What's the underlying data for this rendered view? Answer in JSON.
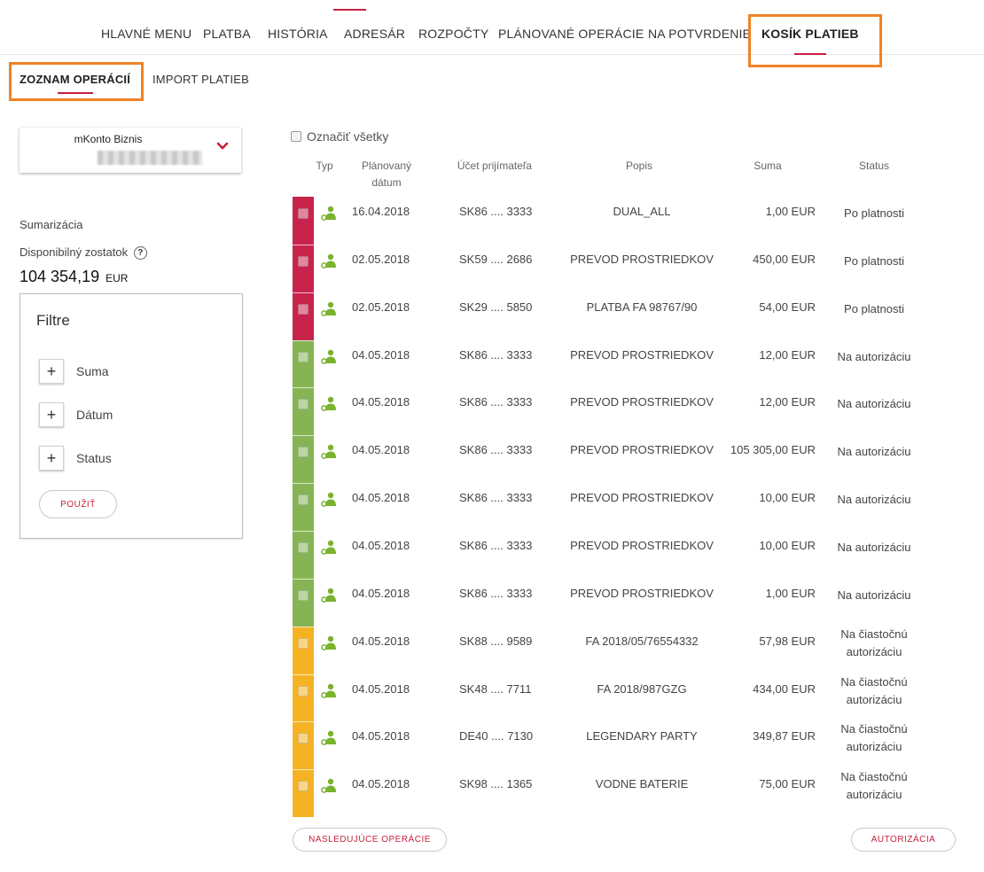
{
  "nav": {
    "items": [
      {
        "label": "HLAVNÉ MENU"
      },
      {
        "label": "PLATBA"
      },
      {
        "label": "HISTÓRIA"
      },
      {
        "label": "ADRESÁR"
      },
      {
        "label": "ROZPOČTY"
      },
      {
        "label": "PLÁNOVANÉ OPERÁCIE"
      },
      {
        "label": "NA POTVRDENIE"
      },
      {
        "label": "KOSÍK PLATIEB",
        "active": true
      }
    ]
  },
  "subnav": {
    "items": [
      {
        "label": "ZOZNAM OPERÁCIÍ",
        "active": true
      },
      {
        "label": "IMPORT PLATIEB"
      }
    ]
  },
  "account": {
    "name": "mKonto Biznis"
  },
  "summary": {
    "title": "Sumarizácia",
    "available_label": "Disponibilný zostatok",
    "help_icon": "?",
    "balance": "104 354,19",
    "currency": "EUR"
  },
  "filters": {
    "title": "Filtre",
    "items": [
      {
        "label": "Suma",
        "icon": "+"
      },
      {
        "label": "Dátum",
        "icon": "+"
      },
      {
        "label": "Status",
        "icon": "+"
      }
    ],
    "apply_label": "POUŽIŤ"
  },
  "table": {
    "select_all_label": "Označiť všetky",
    "headers": {
      "type": "Typ",
      "date_line1": "Plánovaný",
      "date_line2": "dátum",
      "account": "Účet prijímateľa",
      "description": "Popis",
      "amount": "Suma",
      "status": "Status"
    },
    "rows": [
      {
        "date": "16.04.2018",
        "account": "SK86 .... 3333",
        "description": "DUAL_ALL",
        "amount": "1,00 EUR",
        "status1": "Po platnosti",
        "status2": "",
        "color": "red"
      },
      {
        "date": "02.05.2018",
        "account": "SK59 .... 2686",
        "description": "PREVOD PROSTRIEDKOV",
        "amount": "450,00 EUR",
        "status1": "Po platnosti",
        "status2": "",
        "color": "red"
      },
      {
        "date": "02.05.2018",
        "account": "SK29 .... 5850",
        "description": "PLATBA FA 98767/90",
        "amount": "54,00 EUR",
        "status1": "Po platnosti",
        "status2": "",
        "color": "red"
      },
      {
        "date": "04.05.2018",
        "account": "SK86 .... 3333",
        "description": "PREVOD PROSTRIEDKOV",
        "amount": "12,00 EUR",
        "status1": "Na autorizáciu",
        "status2": "",
        "color": "green"
      },
      {
        "date": "04.05.2018",
        "account": "SK86 .... 3333",
        "description": "PREVOD PROSTRIEDKOV",
        "amount": "12,00 EUR",
        "status1": "Na autorizáciu",
        "status2": "",
        "color": "green"
      },
      {
        "date": "04.05.2018",
        "account": "SK86 .... 3333",
        "description": "PREVOD PROSTRIEDKOV",
        "amount": "105 305,00 EUR",
        "status1": "Na autorizáciu",
        "status2": "",
        "color": "green"
      },
      {
        "date": "04.05.2018",
        "account": "SK86 .... 3333",
        "description": "PREVOD PROSTRIEDKOV",
        "amount": "10,00 EUR",
        "status1": "Na autorizáciu",
        "status2": "",
        "color": "green"
      },
      {
        "date": "04.05.2018",
        "account": "SK86 .... 3333",
        "description": "PREVOD PROSTRIEDKOV",
        "amount": "10,00 EUR",
        "status1": "Na autorizáciu",
        "status2": "",
        "color": "green"
      },
      {
        "date": "04.05.2018",
        "account": "SK86 .... 3333",
        "description": "PREVOD PROSTRIEDKOV",
        "amount": "1,00 EUR",
        "status1": "Na autorizáciu",
        "status2": "",
        "color": "green"
      },
      {
        "date": "04.05.2018",
        "account": "SK88 .... 9589",
        "description": "FA 2018/05/76554332",
        "amount": "57,98 EUR",
        "status1": "Na čiastočnú",
        "status2": "autorizáciu",
        "color": "yellow"
      },
      {
        "date": "04.05.2018",
        "account": "SK48 .... 7711",
        "description": "FA 2018/987GZG",
        "amount": "434,00 EUR",
        "status1": "Na čiastočnú",
        "status2": "autorizáciu",
        "color": "yellow"
      },
      {
        "date": "04.05.2018",
        "account": "DE40 .... 7130",
        "description": "LEGENDARY PARTY",
        "amount": "349,87 EUR",
        "status1": "Na čiastočnú",
        "status2": "autorizáciu",
        "color": "yellow"
      },
      {
        "date": "04.05.2018",
        "account": "SK98 .... 1365",
        "description": "VODNE BATERIE",
        "amount": "75,00 EUR",
        "status1": "Na čiastočnú",
        "status2": "autorizáciu",
        "color": "yellow"
      }
    ]
  },
  "actions": {
    "next_label": "NASLEDUJÚCE OPERÁCIE",
    "authorize_label": "AUTORIZÁCIA"
  },
  "colors": {
    "accent": "#c8203f",
    "highlight": "#f08224",
    "red": "#c8234b",
    "green": "#86b454",
    "yellow": "#f5b324",
    "icon_green": "#7ab22e"
  }
}
